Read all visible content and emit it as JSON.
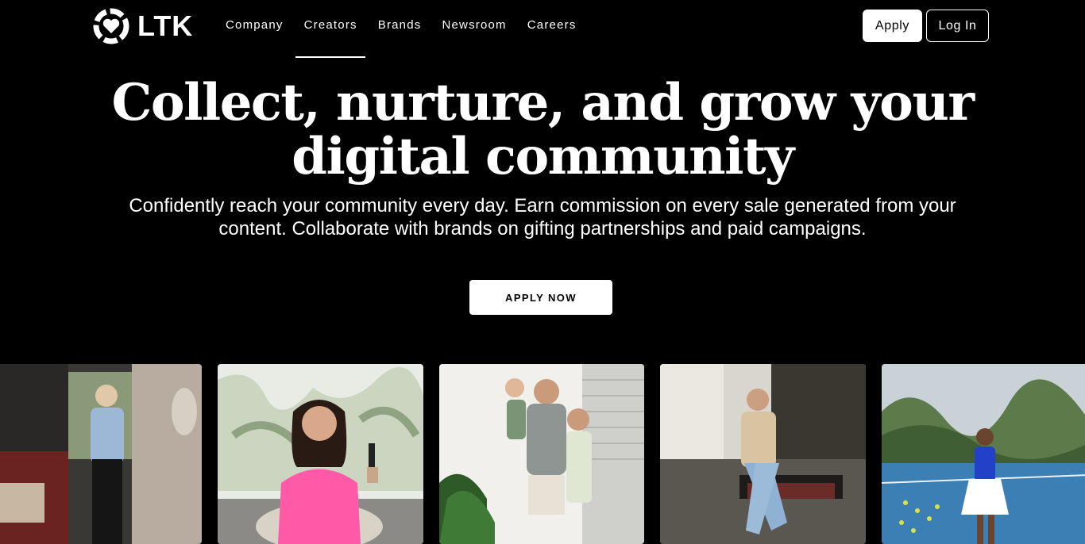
{
  "brand": {
    "logo_text": "LTK",
    "logo_icon": "ltk-heart-badge-icon"
  },
  "nav": {
    "items": [
      {
        "label": "Company"
      },
      {
        "label": "Creators",
        "active": true
      },
      {
        "label": "Brands"
      },
      {
        "label": "Newsroom"
      },
      {
        "label": "Careers"
      }
    ],
    "apply_label": "Apply",
    "login_label": "Log In"
  },
  "hero": {
    "title_line1": "Collect, nurture, and grow your",
    "title_line2": "digital community",
    "subtitle_line1": "Confidently reach your community every day. Earn commission on every sale generated from your",
    "subtitle_line2": "content. Collaborate with brands on gifting partnerships and paid campaigns.",
    "cta_label": "APPLY NOW"
  },
  "colors": {
    "background": "#000000",
    "foreground": "#ffffff"
  },
  "gallery": {
    "photos": [
      {
        "name": "creator-photo-living-room"
      },
      {
        "name": "creator-photo-podcast"
      },
      {
        "name": "creator-photo-family"
      },
      {
        "name": "creator-photo-coffee"
      },
      {
        "name": "creator-photo-tennis"
      }
    ]
  }
}
